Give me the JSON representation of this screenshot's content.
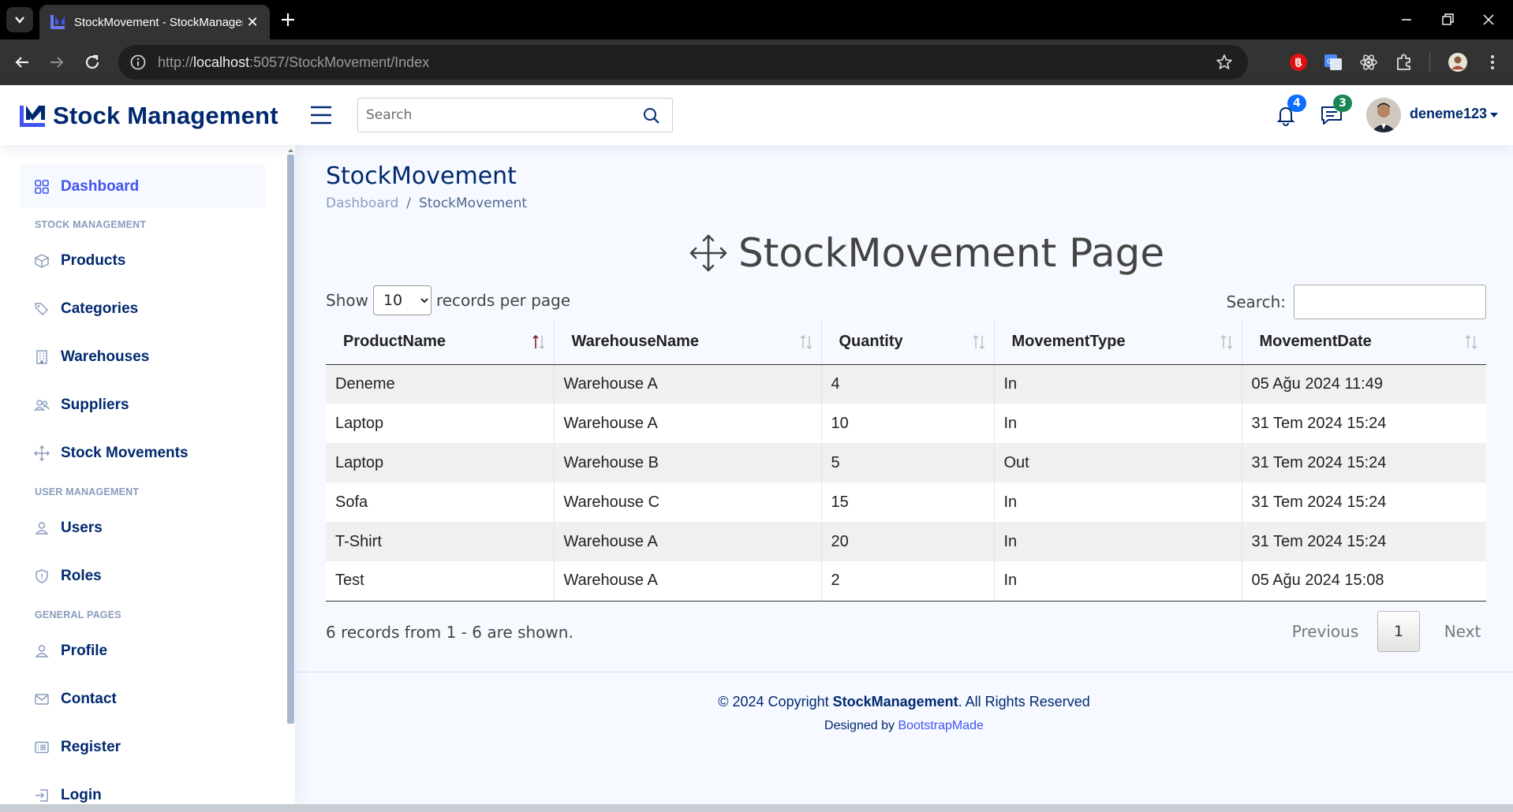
{
  "browser": {
    "tab_title": "StockMovement - StockManagement",
    "url_host": "http://localhost",
    "url_rest": ":5057/StockMovement/Index",
    "url_prefix_gray": "http://",
    "url_host_bold": "localhost"
  },
  "header": {
    "brand": "Stock Management",
    "search_placeholder": "Search",
    "notifications_count": "4",
    "messages_count": "3",
    "username": "deneme123"
  },
  "sidebar": {
    "dashboard": "Dashboard",
    "section_stock": "STOCK MANAGEMENT",
    "products": "Products",
    "categories": "Categories",
    "warehouses": "Warehouses",
    "suppliers": "Suppliers",
    "stock_movements": "Stock Movements",
    "section_user": "USER MANAGEMENT",
    "users": "Users",
    "roles": "Roles",
    "section_general": "GENERAL PAGES",
    "profile": "Profile",
    "contact": "Contact",
    "register": "Register",
    "login": "Login"
  },
  "page": {
    "title": "StockMovement",
    "breadcrumb_home": "Dashboard",
    "breadcrumb_sep": "/",
    "breadcrumb_current": "StockMovement",
    "heading": "StockMovement Page"
  },
  "datatable": {
    "show_label": "Show",
    "page_size": "10",
    "page_size_options": [
      "10"
    ],
    "per_page_label": "records per page",
    "search_label": "Search:",
    "columns": [
      "ProductName",
      "WarehouseName",
      "Quantity",
      "MovementType",
      "MovementDate"
    ],
    "rows": [
      [
        "Deneme",
        "Warehouse A",
        "4",
        "In",
        "05 Ağu 2024 11:49"
      ],
      [
        "Laptop",
        "Warehouse A",
        "10",
        "In",
        "31 Tem 2024 15:24"
      ],
      [
        "Laptop",
        "Warehouse B",
        "5",
        "Out",
        "31 Tem 2024 15:24"
      ],
      [
        "Sofa",
        "Warehouse C",
        "15",
        "In",
        "31 Tem 2024 15:24"
      ],
      [
        "T-Shirt",
        "Warehouse A",
        "20",
        "In",
        "31 Tem 2024 15:24"
      ],
      [
        "Test",
        "Warehouse A",
        "2",
        "In",
        "05 Ağu 2024 15:08"
      ]
    ],
    "info": "6 records from 1 - 6 are shown.",
    "prev_label": "Previous",
    "current_page": "1",
    "next_label": "Next"
  },
  "footer": {
    "copyright_prefix": "© 2024 Copyright ",
    "copyright_brand": "StockManagement",
    "copyright_suffix": ". All Rights Reserved",
    "designed_by": "Designed by ",
    "designer": "BootstrapMade"
  },
  "colors": {
    "brand_navy": "#012970",
    "accent_blue": "#4154f1",
    "sidebar_icon": "#899bbd",
    "page_bg": "#f6f9ff"
  }
}
